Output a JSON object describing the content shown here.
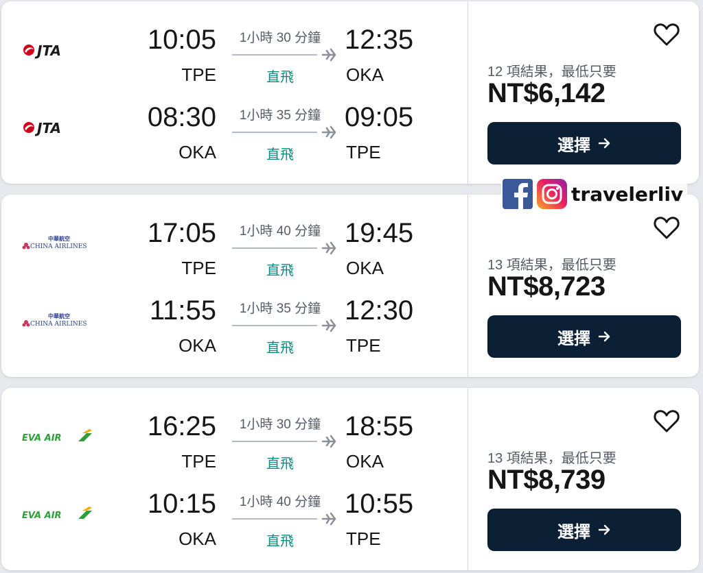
{
  "results": [
    {
      "legs": [
        {
          "airline": "JTA",
          "dep_time": "10:05",
          "dep_code": "TPE",
          "duration": "1小時 30 分鐘",
          "stops": "直飛",
          "arr_time": "12:35",
          "arr_code": "OKA"
        },
        {
          "airline": "JTA",
          "dep_time": "08:30",
          "dep_code": "OKA",
          "duration": "1小時 35 分鐘",
          "stops": "直飛",
          "arr_time": "09:05",
          "arr_code": "TPE"
        }
      ],
      "result_count": "12 項結果，最低只要",
      "price": "NT$6,142",
      "select_label": "選擇"
    },
    {
      "legs": [
        {
          "airline": "CHINA AIRLINES",
          "dep_time": "17:05",
          "dep_code": "TPE",
          "duration": "1小時 40 分鐘",
          "stops": "直飛",
          "arr_time": "19:45",
          "arr_code": "OKA"
        },
        {
          "airline": "CHINA AIRLINES",
          "dep_time": "11:55",
          "dep_code": "OKA",
          "duration": "1小時 35 分鐘",
          "stops": "直飛",
          "arr_time": "12:30",
          "arr_code": "TPE"
        }
      ],
      "result_count": "13 項結果，最低只要",
      "price": "NT$8,723",
      "select_label": "選擇"
    },
    {
      "legs": [
        {
          "airline": "EVA AIR",
          "dep_time": "16:25",
          "dep_code": "TPE",
          "duration": "1小時 30 分鐘",
          "stops": "直飛",
          "arr_time": "18:55",
          "arr_code": "OKA"
        },
        {
          "airline": "EVA AIR",
          "dep_time": "10:15",
          "dep_code": "OKA",
          "duration": "1小時 40 分鐘",
          "stops": "直飛",
          "arr_time": "10:55",
          "arr_code": "TPE"
        }
      ],
      "result_count": "13 項結果，最低只要",
      "price": "NT$8,739",
      "select_label": "選擇"
    }
  ],
  "watermark": {
    "handle": "travelerliv",
    "icons": [
      "facebook-icon",
      "instagram-icon"
    ]
  },
  "colors": {
    "button_bg": "#0b1f35",
    "direct_text": "#0b8a7f",
    "jta_red": "#d0021b",
    "china_airlines_pink": "#c8385e",
    "eva_green": "#2e9e3a"
  }
}
